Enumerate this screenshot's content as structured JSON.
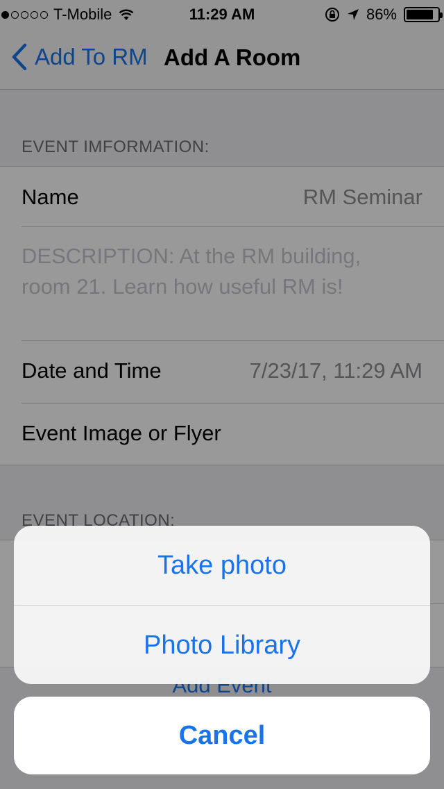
{
  "status": {
    "carrier": "T-Mobile",
    "time": "11:29 AM",
    "battery": "86%",
    "battery_level": 0.86,
    "signal_bars": 1
  },
  "nav": {
    "back_label": "Add To RM",
    "title": "Add A Room"
  },
  "form": {
    "section_event_info": "EVENT IMFORMATION:",
    "name_label": "Name",
    "name_value": "RM Seminar",
    "description": "DESCRIPTION: At the RM building, room 21. Learn how useful RM is!",
    "date_label": "Date and Time",
    "date_value": "7/23/17, 11:29 AM",
    "image_label": "Event Image or Flyer",
    "section_location": "EVENT LOCATION:",
    "add_event_label": "Add Event"
  },
  "action_sheet": {
    "take_photo": "Take photo",
    "photo_library": "Photo Library",
    "cancel": "Cancel"
  },
  "colors": {
    "accent": "#1a73e8"
  }
}
